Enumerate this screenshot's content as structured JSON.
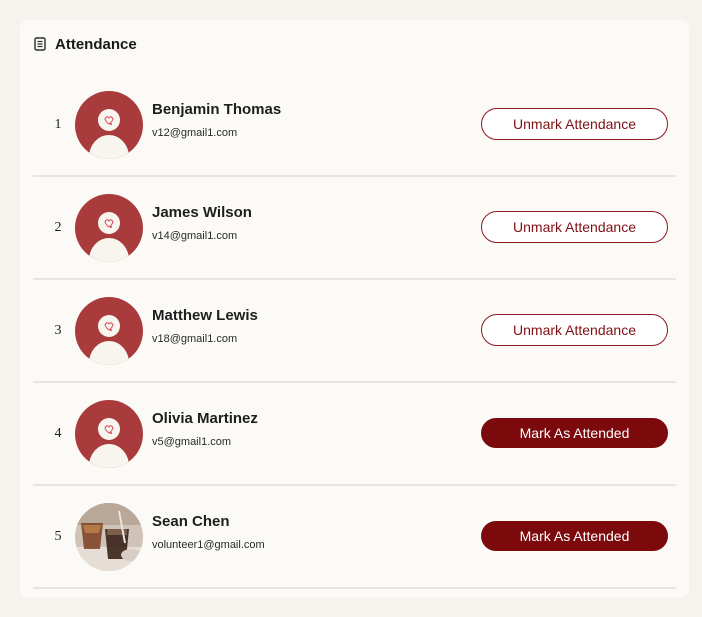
{
  "card": {
    "title": "Attendance",
    "icon": "document-icon"
  },
  "colors": {
    "accent": "#7c0a0c",
    "avatar_bg": "#a93b3c",
    "background": "#f4f3ee",
    "card": "#fbfaf7"
  },
  "attendees": [
    {
      "index": "1",
      "name": "Benjamin Thomas",
      "email": "v12@gmail1.com",
      "avatar": "default-avatar-icon",
      "action": "Unmark Attendance",
      "attended": true
    },
    {
      "index": "2",
      "name": "James Wilson",
      "email": "v14@gmail1.com",
      "avatar": "default-avatar-icon",
      "action": "Unmark Attendance",
      "attended": true
    },
    {
      "index": "3",
      "name": "Matthew Lewis",
      "email": "v18@gmail1.com",
      "avatar": "default-avatar-icon",
      "action": "Unmark Attendance",
      "attended": true
    },
    {
      "index": "4",
      "name": "Olivia Martinez",
      "email": "v5@gmail1.com",
      "avatar": "default-avatar-icon",
      "action": "Mark As Attended",
      "attended": false
    },
    {
      "index": "5",
      "name": "Sean Chen",
      "email": "volunteer1@gmail.com",
      "avatar": "photo-avatar",
      "action": "Mark As Attended",
      "attended": false
    }
  ]
}
